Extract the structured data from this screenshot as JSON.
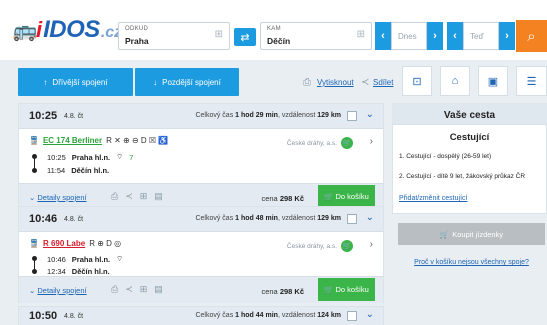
{
  "header": {
    "logo_text": "IDOS",
    "logo_suffix": ".cz",
    "from_label": "ODKUD",
    "from_value": "Praha",
    "to_label": "KAM",
    "to_value": "Děčín",
    "date_value": "Dnes",
    "time_value": "Teď"
  },
  "toolbar": {
    "earlier_label": "Dřívější spojení",
    "later_label": "Pozdější spojení",
    "print_label": "Vytisknout",
    "share_label": "Sdílet"
  },
  "connections": [
    {
      "time": "10:25",
      "date": "4.8. čt",
      "summary_prefix": "Celkový čas ",
      "duration": "1 hod 29 min",
      "summary_mid": ", vzdálenost ",
      "distance": "129 km",
      "train_name": "EC 174 Berliner",
      "train_features": "R ✕ ⊕ ⊖ D ☒ ♿",
      "train_extra": "",
      "carrier": "České dráhy, a.s.",
      "dep_time": "10:25",
      "dep_station": "Praha hl.n.",
      "dep_note": "7",
      "arr_time": "11:54",
      "arr_station": "Děčín hl.n.",
      "details_label": "Detaily spojení",
      "price_prefix": "cena ",
      "price": "298 Kč",
      "cart_label": "Do košíku"
    },
    {
      "time": "10:46",
      "date": "4.8. čt",
      "summary_prefix": "Celkový čas ",
      "duration": "1 hod 48 min",
      "summary_mid": ", vzdálenost ",
      "distance": "129 km",
      "train_name": "R 690 Labe",
      "train_features": "R ⊕ D ◎",
      "train_extra": "",
      "carrier": "České dráhy, a.s.",
      "dep_time": "10:46",
      "dep_station": "Praha hl.n.",
      "dep_note": "",
      "arr_time": "12:34",
      "arr_station": "Děčín hl.n.",
      "details_label": "Detaily spojení",
      "price_prefix": "cena ",
      "price": "298 Kč",
      "cart_label": "Do košíku"
    },
    {
      "time": "10:50",
      "date": "4.8. čt",
      "summary_prefix": "Celkový čas ",
      "duration": "1 hod 44 min",
      "summary_mid": ", vzdálenost ",
      "distance": "124 km"
    }
  ],
  "panel": {
    "title": "Vaše cesta",
    "travelers_heading": "Cestující",
    "traveler_1": "1. Cestující - dospělý (26-59 let)",
    "traveler_2": "2. Cestující - dítě 9 let, žákovský průkaz ČR",
    "edit_link": "Přidat/změnit cestující",
    "buy_label": "Koupit jízdenky",
    "question_link": "Proč v košíku nejsou všechny spoje?"
  },
  "colors": {
    "accent_blue": "#1d9be0",
    "cart_green": "#3bb44a",
    "search_orange": "#f58220",
    "train_name_red": "#d41d2b"
  }
}
